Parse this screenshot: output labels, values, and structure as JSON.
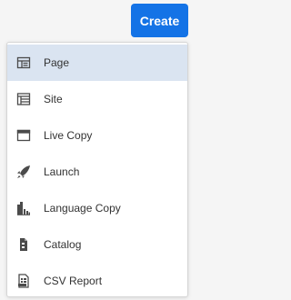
{
  "toolbar": {
    "create_label": "Create"
  },
  "menu": {
    "items": [
      {
        "label": "Page",
        "icon": "page-icon",
        "selected": true
      },
      {
        "label": "Site",
        "icon": "site-icon"
      },
      {
        "label": "Live Copy",
        "icon": "live-copy-icon"
      },
      {
        "label": "Launch",
        "icon": "launch-icon"
      },
      {
        "label": "Language Copy",
        "icon": "language-copy-icon"
      },
      {
        "label": "Catalog",
        "icon": "catalog-icon"
      },
      {
        "label": "CSV Report",
        "icon": "csv-report-icon"
      }
    ]
  },
  "colors": {
    "accent": "#1473e6",
    "selected_bg": "#dae4f1",
    "text": "#323232",
    "icon": "#4b4b4b"
  }
}
